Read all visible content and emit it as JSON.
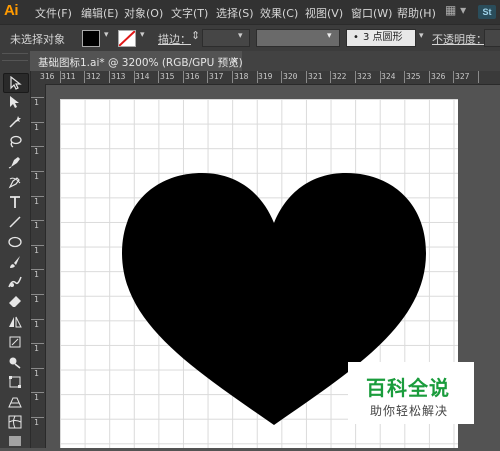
{
  "app": {
    "logo": "Ai",
    "bridge_logo": "St"
  },
  "menu": [
    {
      "label": "文件(F)"
    },
    {
      "label": "编辑(E)"
    },
    {
      "label": "对象(O)"
    },
    {
      "label": "文字(T)"
    },
    {
      "label": "选择(S)"
    },
    {
      "label": "效果(C)"
    },
    {
      "label": "视图(V)"
    },
    {
      "label": "窗口(W)"
    },
    {
      "label": "帮助(H)"
    }
  ],
  "control_bar": {
    "selection_status": "未选择对象",
    "fill_color": "#000000",
    "stroke_color": "none",
    "stroke_label": "描边：",
    "stroke_weight": "",
    "brush_definition": "3 点圆形",
    "opacity_label": "不透明度："
  },
  "document_tab": {
    "title": "基础图标1.ai* @ 3200% (RGB/GPU 预览)",
    "close": "×"
  },
  "rulers": {
    "horizontal": [
      "316",
      "311",
      "312",
      "313",
      "314",
      "315",
      "316",
      "317",
      "318",
      "319",
      "320",
      "321",
      "322",
      "323",
      "324",
      "325",
      "326",
      "327"
    ],
    "vertical": [
      "1",
      "1",
      "1",
      "1",
      "1",
      "1",
      "1",
      "1",
      "1",
      "1",
      "1",
      "1",
      "1",
      "1"
    ]
  },
  "tools": [
    {
      "icon": "selection-tool-icon",
      "active": true
    },
    {
      "icon": "direct-selection-tool-icon"
    },
    {
      "icon": "magic-wand-tool-icon"
    },
    {
      "icon": "lasso-tool-icon"
    },
    {
      "icon": "pen-tool-icon"
    },
    {
      "icon": "curvature-tool-icon"
    },
    {
      "icon": "type-tool-icon"
    },
    {
      "icon": "line-segment-tool-icon"
    },
    {
      "icon": "ellipse-tool-icon"
    },
    {
      "icon": "paintbrush-tool-icon"
    },
    {
      "icon": "shaper-tool-icon"
    },
    {
      "icon": "eraser-tool-icon"
    },
    {
      "icon": "reflect-tool-icon"
    },
    {
      "icon": "width-tool-icon"
    },
    {
      "icon": "shape-builder-tool-icon"
    },
    {
      "icon": "free-transform-tool-icon"
    },
    {
      "icon": "perspective-grid-tool-icon"
    },
    {
      "icon": "mesh-tool-icon"
    },
    {
      "icon": "gradient-tool-icon"
    }
  ],
  "artboard": {
    "shape": "heart",
    "fill": "#000000"
  },
  "watermark": {
    "title": "百科全说",
    "subtitle": "助你轻松解决",
    "color": "#1a9c3c"
  }
}
